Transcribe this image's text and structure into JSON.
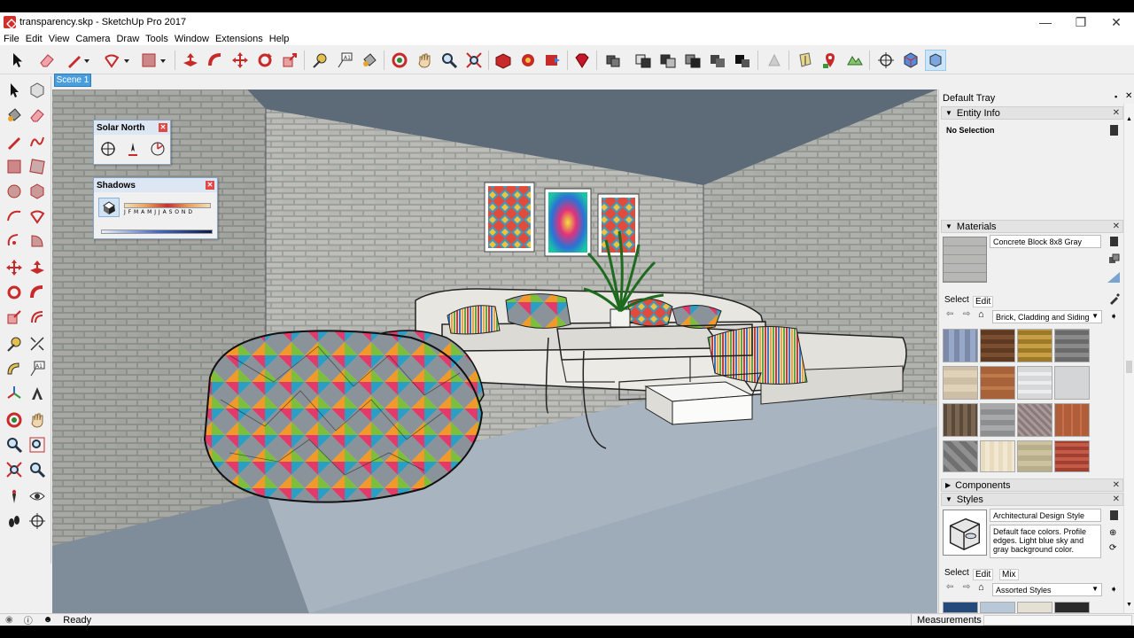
{
  "window": {
    "title": "transparency.skp - SketchUp Pro 2017",
    "controls": [
      "—",
      "❐",
      "✕"
    ]
  },
  "menu": [
    "File",
    "Edit",
    "View",
    "Camera",
    "Draw",
    "Tools",
    "Window",
    "Extensions",
    "Help"
  ],
  "scene_tab": "Scene 1",
  "floating": {
    "solar_north": {
      "title": "Solar North"
    },
    "shadows": {
      "title": "Shadows",
      "months": "J F M A M J J A S O N D"
    }
  },
  "tray": {
    "title": "Default Tray",
    "entity_info": {
      "label": "Entity Info",
      "selection": "No Selection"
    },
    "materials": {
      "label": "Materials",
      "material_name": "Concrete Block 8x8 Gray",
      "tabs": [
        "Select",
        "Edit"
      ],
      "collection": "Brick, Cladding and Siding"
    },
    "components": {
      "label": "Components"
    },
    "styles": {
      "label": "Styles",
      "style_name": "Architectural Design Style",
      "description": "Default face colors. Profile edges. Light blue sky and gray background color.",
      "tabs": [
        "Select",
        "Edit",
        "Mix"
      ],
      "collection": "Assorted Styles"
    }
  },
  "status": {
    "text": "Ready",
    "measurements_label": "Measurements"
  },
  "colors": {
    "accent": "#4a9ede",
    "brand_red": "#d0302a"
  }
}
